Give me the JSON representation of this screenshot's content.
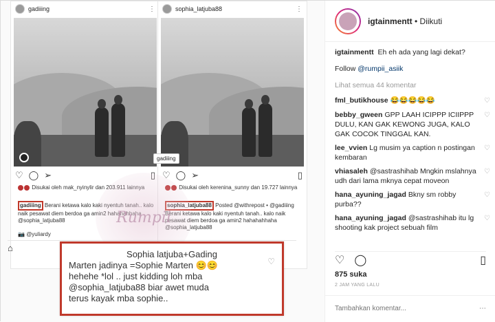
{
  "left_shot": {
    "username": "gadiiing",
    "liked_by": "Disukai oleh mak_nyinylir dan 203.911 lainnya",
    "caption_user": "gadiiing",
    "caption_text": "Berani ketawa kalo kaki nyentuh tanah.. kalo naik pesawat diem berdoa ga amin2 hahahahhaha @sophia_latjuba88",
    "byline": "@yuliardy"
  },
  "right_shot": {
    "username": "sophia_latjuba88",
    "tag": "gadiiing",
    "liked_by": "Disukai oleh kerenina_sunny dan 19.727 lainnya",
    "caption_user": "sophia_latjuba88",
    "caption_text": "Posted @withrepost • @gadiiing Berani ketawa kalo kaki nyentuh tanah.. kalo naik pesawat diem berdoa ga amin2 hahahahhaha @sophia_latjuba88"
  },
  "comment_screenshot": {
    "line1": "Sophia latjuba+Gading",
    "line2": "Marten jadinya =Sophie Marten 😊😊",
    "line3": "hehehe *lol .. just kidding loh mba",
    "line4": "@sophia_latjuba88  biar awet muda",
    "line5": "terus kayak mba sophie.."
  },
  "panel": {
    "owner": "igtainmentt",
    "follow_state": "• Diikuti",
    "caption_user": "igtainmentt",
    "caption_text": "Eh eh ada yang lagi dekat?",
    "follow_prefix": "Follow",
    "follow_mention": "@rumpii_asiik",
    "view_all": "Lihat semua 44 komentar",
    "comments": [
      {
        "user": "fml_butikhouse",
        "text": "😂😂😂😂😂"
      },
      {
        "user": "bebby_gween",
        "text": "GPP LAAH ICIPPP ICIIPPP DULU, KAN GAK KEWONG JUGA, KALO GAK COCOK TINGGAL KAN."
      },
      {
        "user": "lee_vvien",
        "text": "Lg musim ya caption n postingan kembaran"
      },
      {
        "user": "vhiasaleh",
        "text": "@sastrashihab Mngkin mslahnya udh dari lama mknya cepat moveon"
      },
      {
        "user": "hana_ayuning_jagad",
        "text": "Bkny sm robby purba??"
      },
      {
        "user": "hana_ayuning_jagad",
        "text": "@sastrashihab itu lg shooting kak project sebuah film"
      }
    ],
    "likes": "875 suka",
    "time": "2 JAM YANG LALU",
    "add_comment_placeholder": "Tambahkan komentar..."
  },
  "watermark": "Rumpii"
}
